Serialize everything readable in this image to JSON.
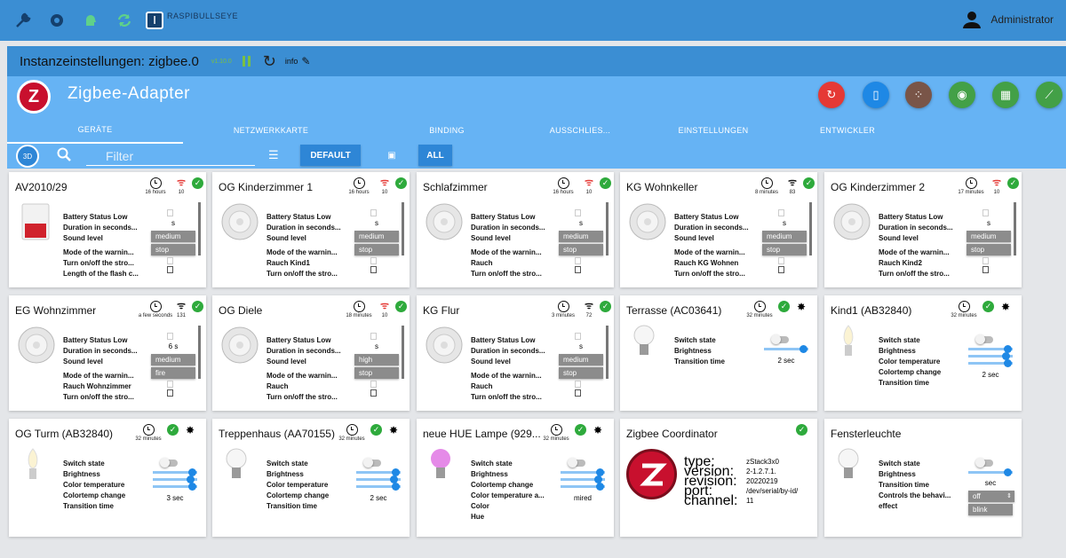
{
  "topbar": {
    "host": "RASPIBULLSEYE",
    "user": "Administrator",
    "icons": [
      "wrench-icon",
      "settings-icon",
      "brain-icon",
      "refresh-arrows-icon",
      "iobroker-logo-icon",
      "user-icon"
    ]
  },
  "instance": {
    "title": "Instanzeinstellungen: zigbee.0",
    "version": "v1.10.0",
    "info": "info"
  },
  "adapter": {
    "name": "Zigbee-Adapter",
    "logo_letter": "Z",
    "actions": [
      {
        "name": "restart",
        "color": "#e53935",
        "icon": "↻"
      },
      {
        "name": "pair-code",
        "color": "#1e88e5",
        "icon": "▯"
      },
      {
        "name": "touchlink",
        "color": "#795548",
        "icon": "⁘"
      },
      {
        "name": "pairing",
        "color": "#43a047",
        "icon": "◉"
      },
      {
        "name": "zigbee-map",
        "color": "#43a047",
        "icon": "▦"
      },
      {
        "name": "scan",
        "color": "#43a047",
        "icon": "⟋"
      }
    ],
    "tabs": [
      "GERÄTE",
      "NETZWERKKARTE",
      "BINDING",
      "AUSSCHLIES...",
      "EINSTELLUNGEN",
      "ENTWICKLER"
    ],
    "active_tab": "GERÄTE"
  },
  "filterbar": {
    "button_3d": "3D",
    "filter_placeholder": "Filter",
    "btn_default": "DEFAULT",
    "btn_all": "ALL"
  },
  "colors": {
    "topbar": "#3b8ed3",
    "adapter": "#66b3f4",
    "ok": "#2eaa3c",
    "alert": "#e53935"
  },
  "devices": [
    {
      "title": "AV2010/29",
      "age": "16 hours",
      "signal": "10",
      "signal_color": "red",
      "type": "siren-box",
      "props": [
        "Battery Status Low",
        "Duration in seconds...",
        "Sound level",
        "Mode of the warnin...",
        "Turn on/off the stro...",
        "Length of the flash c..."
      ],
      "vals": {
        "duration": "s",
        "sound": "medium",
        "mode": "stop"
      }
    },
    {
      "title": "OG Kinderzimmer 1",
      "age": "16 hours",
      "signal": "10",
      "signal_color": "red",
      "type": "smoke",
      "props": [
        "Battery Status Low",
        "Duration in seconds...",
        "Sound level",
        "Mode of the warnin...",
        "Rauch Kind1",
        "Turn on/off the stro..."
      ],
      "vals": {
        "duration": "s",
        "sound": "medium",
        "mode": "stop"
      }
    },
    {
      "title": "Schlafzimmer",
      "age": "16 hours",
      "signal": "10",
      "signal_color": "red",
      "type": "smoke",
      "props": [
        "Battery Status Low",
        "Duration in seconds...",
        "Sound level",
        "Mode of the warnin...",
        "Rauch",
        "Turn on/off the stro..."
      ],
      "vals": {
        "duration": "s",
        "sound": "medium",
        "mode": "stop"
      }
    },
    {
      "title": "KG Wohnkeller",
      "age": "8 minutes",
      "signal": "83",
      "signal_color": "black",
      "type": "smoke",
      "props": [
        "Battery Status Low",
        "Duration in seconds...",
        "Sound level",
        "Mode of the warnin...",
        "Rauch KG Wohnen",
        "Turn on/off the stro..."
      ],
      "vals": {
        "duration": "s",
        "sound": "medium",
        "mode": "stop"
      }
    },
    {
      "title": "OG Kinderzimmer 2",
      "age": "17 minutes",
      "signal": "10",
      "signal_color": "red",
      "type": "smoke",
      "props": [
        "Battery Status Low",
        "Duration in seconds...",
        "Sound level",
        "Mode of the warnin...",
        "Rauch Kind2",
        "Turn on/off the stro..."
      ],
      "vals": {
        "duration": "s",
        "sound": "medium",
        "mode": "stop"
      }
    },
    {
      "title": "EG Wohnzimmer",
      "age": "a few seconds",
      "signal": "131",
      "signal_color": "black",
      "type": "smoke",
      "props": [
        "Battery Status Low",
        "Duration in seconds...",
        "Sound level",
        "Mode of the warnin...",
        "Rauch Wohnzimmer",
        "Turn on/off the stro..."
      ],
      "vals": {
        "duration": "6 s",
        "sound": "medium",
        "mode": "fire"
      }
    },
    {
      "title": "OG Diele",
      "age": "18 minutes",
      "signal": "10",
      "signal_color": "red",
      "type": "smoke",
      "props": [
        "Battery Status Low",
        "Duration in seconds...",
        "Sound level",
        "Mode of the warnin...",
        "Rauch",
        "Turn on/off the stro..."
      ],
      "vals": {
        "duration": "s",
        "sound": "high",
        "mode": "stop"
      }
    },
    {
      "title": "KG Flur",
      "age": "3 minutes",
      "signal": "72",
      "signal_color": "black",
      "type": "smoke",
      "props": [
        "Battery Status Low",
        "Duration in seconds...",
        "Sound level",
        "Mode of the warnin...",
        "Rauch",
        "Turn on/off the stro..."
      ],
      "vals": {
        "duration": "s",
        "sound": "medium",
        "mode": "stop"
      }
    },
    {
      "title": "Terrasse (AC03641)",
      "age": "32 minutes",
      "type": "bulb",
      "props": [
        "Switch state",
        "Brightness",
        "Transition time"
      ],
      "transition": "2 sec"
    },
    {
      "title": "Kind1 (AB32840)",
      "age": "32 minutes",
      "type": "candle",
      "props": [
        "Switch state",
        "Brightness",
        "Color temperature",
        "Colortemp change",
        "Transition time"
      ],
      "transition": "2 sec"
    },
    {
      "title": "OG Turm (AB32840)",
      "age": "32 minutes",
      "type": "candle",
      "props": [
        "Switch state",
        "Brightness",
        "Color temperature",
        "Colortemp change",
        "Transition time"
      ],
      "transition": "3 sec"
    },
    {
      "title": "Treppenhaus (AA70155)",
      "age": "32 minutes",
      "type": "bulb",
      "props": [
        "Switch state",
        "Brightness",
        "Color temperature",
        "Colortemp change",
        "Transition time"
      ],
      "transition": "2 sec"
    },
    {
      "title": "neue HUE Lampe (929...",
      "age": "32 minutes",
      "type": "hue",
      "props": [
        "Switch state",
        "Brightness",
        "Colortemp change",
        "Color temperature a...",
        "Color",
        "Hue"
      ],
      "unit": "mired"
    },
    {
      "title": "Zigbee Coordinator",
      "type": "coordinator",
      "props": [
        "type:",
        "version:",
        "revision:",
        "port:",
        "channel:"
      ],
      "coord": [
        "zStack3x0",
        "2-1.2.7.1.",
        "20220219",
        "/dev/serial/by-id/",
        "11"
      ]
    },
    {
      "title": "Fensterleuchte",
      "type": "candle-bulb",
      "props": [
        "Switch state",
        "Brightness",
        "Transition time",
        "Controls the behavi...",
        "effect"
      ],
      "transition": "sec",
      "behavior": "off",
      "effect": "blink"
    }
  ]
}
